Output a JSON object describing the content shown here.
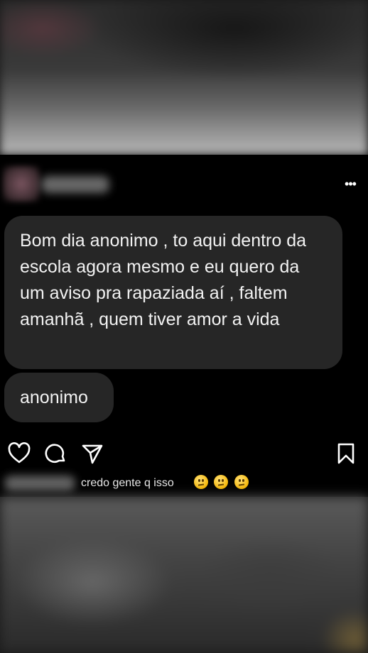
{
  "post": {
    "more_label": "•••",
    "messages": [
      {
        "text": "Bom dia anonimo , to aqui dentro da escola agora mesmo e eu quero da um aviso pra rapaziada aí , faltem amanhã , quem tiver amor a vida"
      },
      {
        "text": "anonimo"
      }
    ],
    "actions": {
      "like_icon": "heart-icon",
      "comment_icon": "comment-icon",
      "share_icon": "send-icon",
      "save_icon": "bookmark-icon"
    },
    "comment": {
      "text": "credo gente q isso",
      "emoji_icons": [
        "face-with-diagonal-mouth-emoji",
        "face-with-diagonal-mouth-emoji",
        "face-with-diagonal-mouth-emoji"
      ]
    }
  },
  "colors": {
    "post_background": "#000000",
    "bubble_background": "#262626",
    "text": "#f2f2f2"
  }
}
